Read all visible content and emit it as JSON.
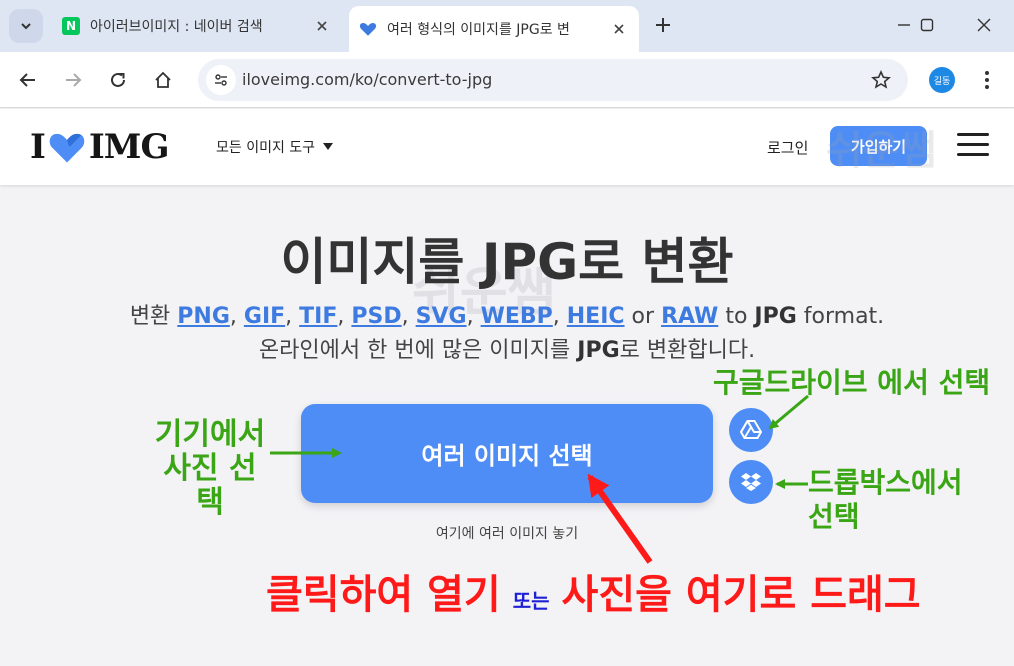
{
  "browser": {
    "tabs": [
      {
        "title": "아이러브이미지 : 네이버 검색",
        "favicon": "naver-n-icon",
        "favicon_text": "N",
        "active": false
      },
      {
        "title": "여러 형식의 이미지를 JPG로 변",
        "favicon": "heart-icon",
        "active": true
      }
    ],
    "url": "iloveimg.com/ko/convert-to-jpg",
    "profile_label": "길동"
  },
  "site": {
    "logo_left": "I",
    "logo_right": "IMG",
    "tools_menu": "모든 이미지 도구",
    "login": "로그인",
    "signup": "가입하기"
  },
  "main": {
    "title": "이미지를 JPG로 변환",
    "subtitle_prefix": "변환",
    "formats": [
      "PNG",
      "GIF",
      "TIF",
      "PSD",
      "SVG",
      "WEBP",
      "HEIC"
    ],
    "or": "or",
    "format_raw": "RAW",
    "to": "to",
    "target_format": "JPG",
    "format_word": "format.",
    "line2_prefix": "온라인에서 한 번에 많은 이미지를",
    "line2_format": "JPG",
    "line2_suffix": "로 변환합니다.",
    "select_button": "여러 이미지 선택",
    "drop_hint": "여기에 여러 이미지 놓기"
  },
  "annotations": {
    "device_line1": "기기에서",
    "device_line2": "사진 선택",
    "gdrive": "구글드라이브 에서 선택",
    "dropbox_line1": "드롭박스에서",
    "dropbox_line2": "선택",
    "instruction_a": "클릭하여 열기",
    "instruction_or": "또는",
    "instruction_b": "사진을 여기로 드래그"
  },
  "watermark_text": "쉬운쌤",
  "colors": {
    "accent": "#4d8df5",
    "annotation_green": "#3aa515",
    "annotation_red": "#ff1a1a",
    "annotation_blue": "#1f1fd6"
  }
}
